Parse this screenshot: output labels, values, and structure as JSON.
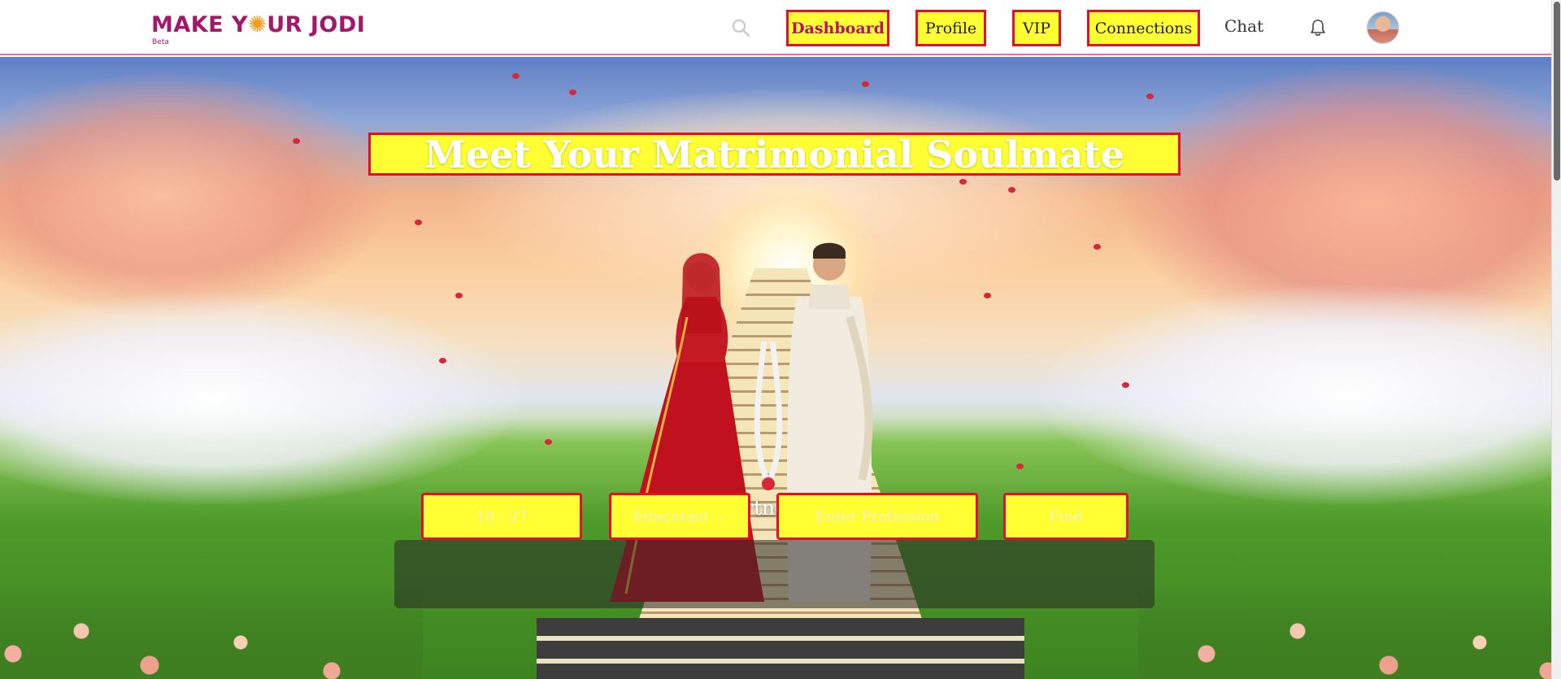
{
  "header": {
    "logo_text": "MAKE Y",
    "logo_text_end": "UR JODI",
    "logo_badge": "Beta",
    "nav": {
      "dashboard": "Dashboard",
      "profile": "Profile",
      "vip": "VIP",
      "connections": "Connections",
      "chat": "Chat"
    },
    "icons": [
      "search-icon",
      "bell-icon",
      "avatar"
    ]
  },
  "hero": {
    "title": "Meet Your Matrimonial Soulmate",
    "prefs_heading": "Add your partner preferences",
    "age_range": "18 - 27",
    "education_label": "Education",
    "profession_placeholder": "Enter Profession",
    "find_label": "Find"
  },
  "colors": {
    "brand": "#a3176a",
    "highlight_fill": "#ffff33",
    "highlight_border": "#e0102a"
  }
}
